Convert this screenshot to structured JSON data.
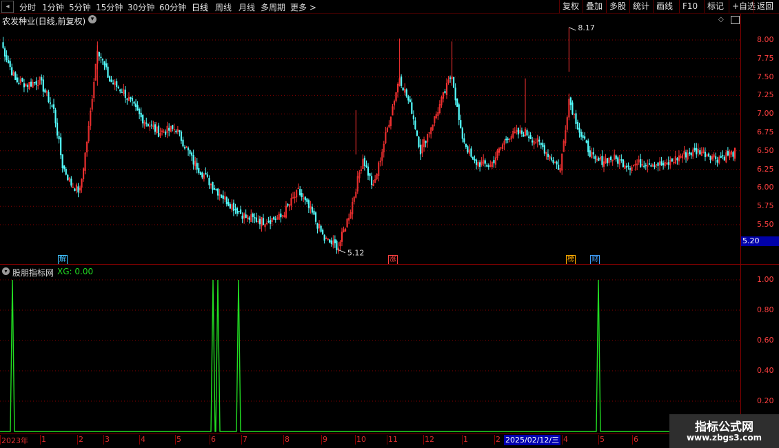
{
  "toolbar": {
    "periods": [
      "分时",
      "1分钟",
      "5分钟",
      "15分钟",
      "30分钟",
      "60分钟",
      "日线",
      "周线",
      "月线",
      "多周期",
      "更多 >"
    ],
    "active_period": "日线",
    "right_buttons": [
      "复权",
      "叠加",
      "多股",
      "统计",
      "画线",
      "F10",
      "标记",
      "+自选",
      "返回"
    ]
  },
  "chart_title": "农发种业(日线,前复权)",
  "indicator": {
    "name": "股朋指标网",
    "value_text": "XG: 0.00"
  },
  "price_axis_labels": [
    "8.00",
    "7.75",
    "7.50",
    "7.25",
    "7.00",
    "6.75",
    "6.50",
    "6.25",
    "6.00",
    "5.75",
    "5.50"
  ],
  "current_price": "5.20",
  "high_marker": "8.17",
  "low_marker": "5.12",
  "indicator_axis_labels": [
    "1.00",
    "0.80",
    "0.60",
    "0.40",
    "0.20"
  ],
  "event_icons": [
    {
      "label": "解",
      "color": "#40c0ff"
    },
    {
      "label": "涨",
      "color": "#ff4040"
    },
    {
      "label": "榜",
      "color": "#ffaa00"
    },
    {
      "label": "财",
      "color": "#40a0ff"
    }
  ],
  "date_axis": [
    "2023年",
    "1",
    "2",
    "3",
    "4",
    "5",
    "6",
    "7",
    "8",
    "9",
    "10",
    "11",
    "12",
    "1",
    "2",
    "3",
    "4",
    "5",
    "6"
  ],
  "cursor_date": "2025/02/12/三",
  "watermark": {
    "line1": "指标公式网",
    "line2": "www.zbgs3.com"
  },
  "colors": {
    "up": "#ff3333",
    "down": "#54ffff",
    "grid": "#8a0000",
    "signal": "#22dd22"
  },
  "chart_data": {
    "type": "candlestick",
    "title": "农发种业(日线,前复权)",
    "ylim": [
      5.1,
      8.2
    ],
    "x_range": [
      "2023年",
      "6"
    ],
    "keypoints_close": [
      [
        0,
        7.95
      ],
      [
        8,
        7.45
      ],
      [
        15,
        7.4
      ],
      [
        22,
        7.45
      ],
      [
        30,
        7.05
      ],
      [
        35,
        6.3
      ],
      [
        40,
        6.05
      ],
      [
        45,
        5.95
      ],
      [
        50,
        6.8
      ],
      [
        55,
        7.9
      ],
      [
        62,
        7.45
      ],
      [
        70,
        7.3
      ],
      [
        80,
        6.95
      ],
      [
        90,
        6.75
      ],
      [
        100,
        6.8
      ],
      [
        110,
        6.35
      ],
      [
        120,
        6.05
      ],
      [
        130,
        5.8
      ],
      [
        140,
        5.6
      ],
      [
        150,
        5.55
      ],
      [
        160,
        5.6
      ],
      [
        170,
        5.95
      ],
      [
        178,
        5.65
      ],
      [
        185,
        5.3
      ],
      [
        193,
        5.2
      ],
      [
        200,
        5.7
      ],
      [
        207,
        6.4
      ],
      [
        213,
        6.0
      ],
      [
        220,
        6.7
      ],
      [
        228,
        7.5
      ],
      [
        235,
        7.05
      ],
      [
        240,
        6.5
      ],
      [
        250,
        7.05
      ],
      [
        258,
        7.55
      ],
      [
        263,
        6.75
      ],
      [
        270,
        6.35
      ],
      [
        280,
        6.3
      ],
      [
        290,
        6.7
      ],
      [
        300,
        6.75
      ],
      [
        310,
        6.55
      ],
      [
        320,
        6.25
      ],
      [
        325,
        7.2
      ],
      [
        332,
        6.7
      ],
      [
        340,
        6.35
      ],
      [
        350,
        6.4
      ],
      [
        360,
        6.3
      ],
      [
        370,
        6.35
      ],
      [
        380,
        6.3
      ],
      [
        390,
        6.45
      ],
      [
        400,
        6.5
      ],
      [
        410,
        6.4
      ],
      [
        420,
        6.48
      ]
    ],
    "indicator_series": {
      "name": "XG",
      "values": [
        0,
        1,
        0,
        0,
        1,
        1,
        0,
        1,
        0,
        0,
        1,
        0
      ],
      "signal_dates": [
        "2023年初",
        "2024年6月",
        "2024年6月",
        "2024年7月",
        "2025年5月"
      ]
    }
  }
}
